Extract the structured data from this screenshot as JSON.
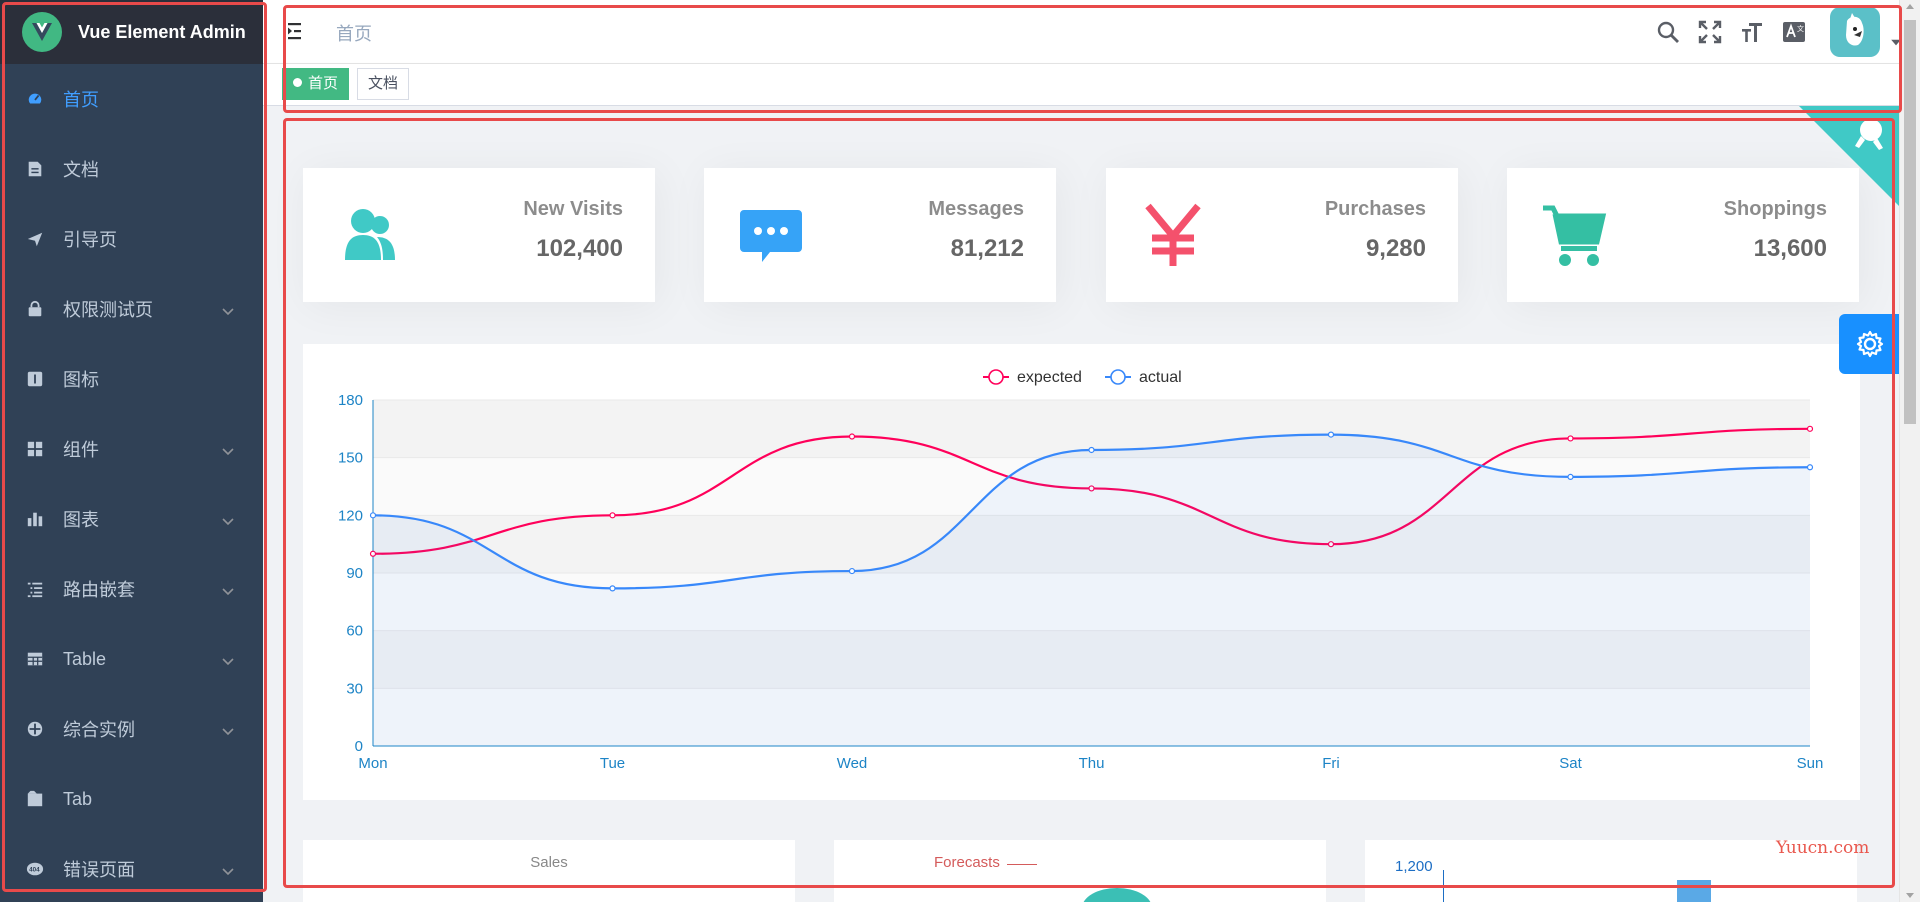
{
  "app": {
    "title": "Vue Element Admin"
  },
  "sidebar": {
    "items": [
      {
        "label": "首页",
        "icon": "dashboard-icon",
        "active": true,
        "has_arrow": false
      },
      {
        "label": "文档",
        "icon": "documentation-icon",
        "active": false,
        "has_arrow": false
      },
      {
        "label": "引导页",
        "icon": "guide-icon",
        "active": false,
        "has_arrow": false
      },
      {
        "label": "权限测试页",
        "icon": "lock-icon",
        "active": false,
        "has_arrow": true
      },
      {
        "label": "图标",
        "icon": "icon-icon",
        "active": false,
        "has_arrow": false
      },
      {
        "label": "组件",
        "icon": "component-icon",
        "active": false,
        "has_arrow": true
      },
      {
        "label": "图表",
        "icon": "chart-icon",
        "active": false,
        "has_arrow": true
      },
      {
        "label": "路由嵌套",
        "icon": "nested-icon",
        "active": false,
        "has_arrow": true
      },
      {
        "label": "Table",
        "icon": "table-icon",
        "active": false,
        "has_arrow": true
      },
      {
        "label": "综合实例",
        "icon": "example-icon",
        "active": false,
        "has_arrow": true
      },
      {
        "label": "Tab",
        "icon": "tab-icon",
        "active": false,
        "has_arrow": false
      },
      {
        "label": "错误页面",
        "icon": "404-icon",
        "active": false,
        "has_arrow": true
      }
    ]
  },
  "header": {
    "breadcrumb": "首页",
    "tools": [
      "search-icon",
      "fullscreen-icon",
      "font-size-icon",
      "language-icon"
    ]
  },
  "tags": [
    {
      "label": "首页",
      "active": true
    },
    {
      "label": "文档",
      "active": false
    }
  ],
  "panels": [
    {
      "label": "New Visits",
      "value": "102,400",
      "icon": "peoples-icon",
      "color": "#40c9c6"
    },
    {
      "label": "Messages",
      "value": "81,212",
      "icon": "message-icon",
      "color": "#36a3f7"
    },
    {
      "label": "Purchases",
      "value": "9,280",
      "icon": "money-icon",
      "color": "#f4516c"
    },
    {
      "label": "Shoppings",
      "value": "13,600",
      "icon": "shopping-icon",
      "color": "#34bfa3"
    }
  ],
  "chart_data": [
    {
      "type": "line",
      "categories": [
        "Mon",
        "Tue",
        "Wed",
        "Thu",
        "Fri",
        "Sat",
        "Sun"
      ],
      "series": [
        {
          "name": "expected",
          "values": [
            100,
            120,
            161,
            134,
            105,
            160,
            165
          ],
          "color": "#ff005a"
        },
        {
          "name": "actual",
          "values": [
            120,
            82,
            91,
            154,
            162,
            140,
            145
          ],
          "color": "#3888fa"
        }
      ],
      "ylim": [
        0,
        180
      ],
      "yticks": [
        0,
        30,
        60,
        90,
        120,
        150,
        180
      ],
      "legend": "top-center",
      "smooth": true
    }
  ],
  "bottom_cards": {
    "sales_label": "Sales",
    "forecasts_label": "Forecasts",
    "bar_top_tick": "1,200"
  },
  "watermark": "Yuucn.com"
}
